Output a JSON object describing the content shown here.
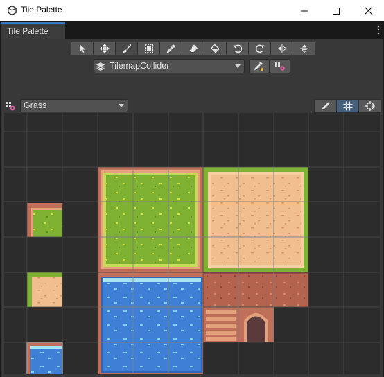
{
  "window": {
    "title": "Tile Palette",
    "controls": {
      "minimize": "—",
      "maximize": "☐",
      "close": "✕"
    }
  },
  "tab": {
    "label": "Tile Palette"
  },
  "toolbar": {
    "tools": [
      {
        "name": "select-tool",
        "icon": "arrow-icon"
      },
      {
        "name": "move-tool",
        "icon": "move-icon"
      },
      {
        "name": "paint-tool",
        "icon": "brush-icon",
        "active": true
      },
      {
        "name": "box-fill-tool",
        "icon": "box-fill-icon"
      },
      {
        "name": "pick-tool",
        "icon": "eyedropper-icon"
      },
      {
        "name": "erase-tool",
        "icon": "eraser-icon"
      },
      {
        "name": "fill-tool",
        "icon": "bucket-icon"
      },
      {
        "name": "rotate-ccw-tool",
        "icon": "rotate-ccw-icon"
      },
      {
        "name": "rotate-cw-tool",
        "icon": "rotate-cw-icon"
      },
      {
        "name": "flip-x-tool",
        "icon": "flip-x-icon"
      },
      {
        "name": "flip-y-tool",
        "icon": "flip-y-icon"
      }
    ]
  },
  "target": {
    "selected": "TilemapCollider"
  },
  "palette": {
    "selected": "Grass"
  },
  "colors": {
    "panel": "#383838",
    "grid_bg": "#2c2c2c",
    "grass": "#7fb233",
    "sand": "#f0bf8d",
    "dirt": "#b4634f",
    "water": "#3f7fd6",
    "accent": "#3a79bb"
  }
}
